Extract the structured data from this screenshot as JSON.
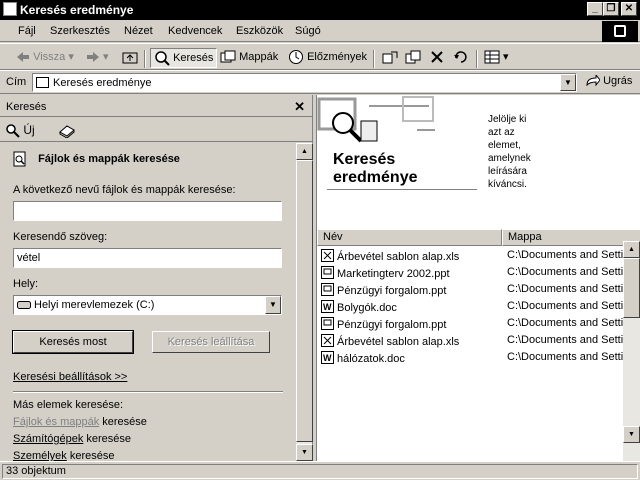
{
  "window": {
    "title": "Keresés eredménye"
  },
  "menu": [
    "Fájl",
    "Szerkesztés",
    "Nézet",
    "Kedvencek",
    "Eszközök",
    "Súgó"
  ],
  "toolbar": {
    "back": "Vissza",
    "search": "Keresés",
    "folders": "Mappák",
    "history": "Előzmények"
  },
  "address": {
    "label": "Cím",
    "value": "Keresés eredménye",
    "go": "Ugrás"
  },
  "search_pane": {
    "title": "Keresés",
    "new_label": "Új",
    "section_title": "Fájlok és mappák keresése",
    "filename_label": "A következő nevű fájlok és mappák keresése:",
    "filename_value": "",
    "text_label": "Keresendő szöveg:",
    "text_value": "vétel",
    "location_label": "Hely:",
    "location_value": "Helyi merevlemezek (C:)",
    "search_now": "Keresés most",
    "reset": "Keresés leállítása",
    "options_link": "Keresési beállítások  >>",
    "other_label": "Más elemek keresése:",
    "other_items": [
      {
        "link": "Fájlok és mappák",
        "suffix": " keresése"
      },
      {
        "link": "Számítógépek",
        "suffix": " keresése"
      },
      {
        "link": "Személyek",
        "suffix": " keresése"
      }
    ]
  },
  "results": {
    "banner_title_1": "Keresés",
    "banner_title_2": "eredménye",
    "hint_lines": [
      "Jelölje ki",
      "azt az",
      "elemet,",
      "amelynek",
      "leírására",
      "kíváncsi."
    ],
    "columns": {
      "name": "Név",
      "folder": "Mappa"
    },
    "rows": [
      {
        "name": "Árbevétel sablon alap.xls",
        "folder": "C:\\Documents and Setti",
        "icon": "xls-icon"
      },
      {
        "name": "Marketingterv 2002.ppt",
        "folder": "C:\\Documents and Setti",
        "icon": "ppt-icon"
      },
      {
        "name": "Pénzügyi forgalom.ppt",
        "folder": "C:\\Documents and Setti",
        "icon": "ppt-icon"
      },
      {
        "name": "Bolygók.doc",
        "folder": "C:\\Documents and Setti",
        "icon": "doc-icon"
      },
      {
        "name": "Pénzügyi forgalom.ppt",
        "folder": "C:\\Documents and Setti",
        "icon": "ppt-icon"
      },
      {
        "name": "Árbevétel sablon alap.xls",
        "folder": "C:\\Documents and Setti",
        "icon": "xls-icon"
      },
      {
        "name": "hálózatok.doc",
        "folder": "C:\\Documents and Setti",
        "icon": "doc-icon"
      }
    ]
  },
  "status": {
    "count": "33 objektum"
  }
}
